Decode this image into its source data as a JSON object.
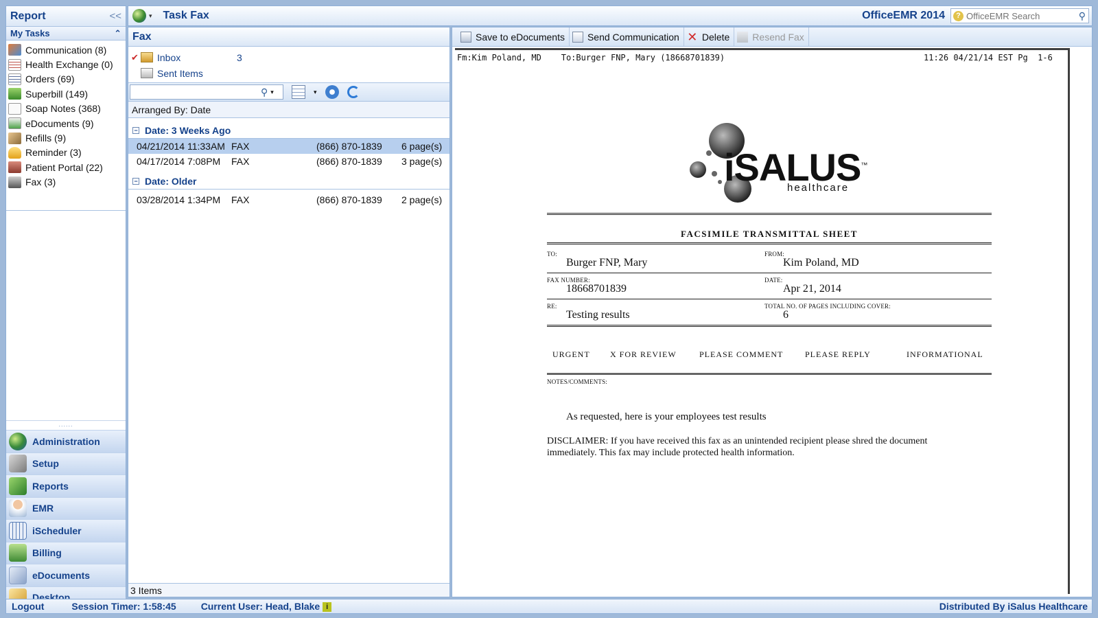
{
  "left_panel": {
    "title": "Report",
    "collapse_glyph": "<<",
    "section_title": "My Tasks",
    "section_collapse_glyph": "⌃",
    "tasks": [
      {
        "label": "Communication (8)",
        "icon": "users-icon"
      },
      {
        "label": "Health Exchange (0)",
        "icon": "exchange-icon"
      },
      {
        "label": "Orders (69)",
        "icon": "orders-icon"
      },
      {
        "label": "Superbill (149)",
        "icon": "superbill-icon"
      },
      {
        "label": "Soap Notes (368)",
        "icon": "note-icon"
      },
      {
        "label": "eDocuments (9)",
        "icon": "edocuments-icon"
      },
      {
        "label": "Refills (9)",
        "icon": "refill-icon"
      },
      {
        "label": "Reminder (3)",
        "icon": "reminder-icon"
      },
      {
        "label": "Patient Portal (22)",
        "icon": "portal-icon"
      },
      {
        "label": "Fax (3)",
        "icon": "fax-icon"
      }
    ],
    "grip": "......",
    "nav": [
      {
        "label": "Administration",
        "icon": "globe-icon"
      },
      {
        "label": "Setup",
        "icon": "tools-icon"
      },
      {
        "label": "Reports",
        "icon": "chart-icon"
      },
      {
        "label": "EMR",
        "icon": "doctor-icon"
      },
      {
        "label": "iScheduler",
        "icon": "calendar-icon"
      },
      {
        "label": "Billing",
        "icon": "billing-icon"
      },
      {
        "label": "eDocuments",
        "icon": "document-icon"
      },
      {
        "label": "Desktop",
        "icon": "desktop-icon"
      }
    ]
  },
  "top_bar": {
    "dropdown_glyph": "▾",
    "title": "Task Fax",
    "brand": "OfficeEMR 2014",
    "search": {
      "help_glyph": "?",
      "placeholder": "OfficeEMR Search",
      "icon_glyph": "⚲"
    }
  },
  "middle_panel": {
    "title": "Fax",
    "folders": [
      {
        "label": "Inbox",
        "count": "3",
        "checked": "✔"
      },
      {
        "label": "Sent Items",
        "count": "",
        "checked": ""
      }
    ],
    "filter": {
      "value": "",
      "search_glyph": "⚲",
      "dd_glyph": "▾"
    },
    "arranged_by": "Arranged By: Date",
    "groups": [
      {
        "title": "Date: 3 Weeks Ago",
        "toggle": "−",
        "rows": [
          {
            "date": "04/21/2014 11:33AM",
            "type": "FAX",
            "number": "(866) 870-1839",
            "pages": "6 page(s)"
          },
          {
            "date": "04/17/2014  7:08PM",
            "type": "FAX",
            "number": "(866) 870-1839",
            "pages": "3 page(s)"
          }
        ]
      },
      {
        "title": "Date: Older",
        "toggle": "−",
        "rows": [
          {
            "date": "03/28/2014  1:34PM",
            "type": "FAX",
            "number": "(866) 870-1839",
            "pages": "2 page(s)"
          }
        ]
      }
    ],
    "footer": "3 Items"
  },
  "document_toolbar": {
    "save": "Save to eDocuments",
    "send": "Send Communication",
    "delete": "Delete",
    "resend": "Resend Fax"
  },
  "fax": {
    "header_left": "Fm:Kim Poland, MD    To:Burger FNP, Mary (18668701839)",
    "header_right": "11:26 04/21/14 EST Pg  1-6",
    "logo_text": "iSALUS",
    "logo_tm": "™",
    "logo_sub": "healthcare",
    "sheet_title": "FACSIMILE TRANSMITTAL SHEET",
    "to_label": "TO:",
    "to_value": "Burger FNP, Mary",
    "from_label": "FROM:",
    "from_value": "Kim Poland, MD",
    "fax_number_label": "FAX NUMBER:",
    "fax_number_value": "18668701839",
    "date_label": "DATE:",
    "date_value": "Apr 21, 2014",
    "re_label": "RE:",
    "re_value": "Testing results",
    "total_pages_label": "TOTAL NO. OF PAGES INCLUDING COVER:",
    "total_pages_value": "6",
    "checks": [
      "URGENT",
      "X FOR REVIEW",
      "PLEASE COMMENT",
      "PLEASE REPLY",
      "INFORMATIONAL"
    ],
    "notes_label": "NOTES/COMMENTS:",
    "message": "As requested, here is your employees test results",
    "disclaimer_1": "DISCLAIMER: If you have received this fax as an unintended recipient please shred the document",
    "disclaimer_2": "immediately. This fax may include protected health information."
  },
  "status_bar": {
    "logout": "Logout",
    "session_timer": "Session Timer: 1:58:45",
    "current_user": "Current User: Head, Blake",
    "info_glyph": "i",
    "distributed_by": "Distributed By iSalus Healthcare"
  },
  "colors": {
    "accent": "#15428b",
    "panel_border": "#8fb0d8",
    "selected_row": "#b7cfee",
    "app_background": "#9fb9d9"
  }
}
